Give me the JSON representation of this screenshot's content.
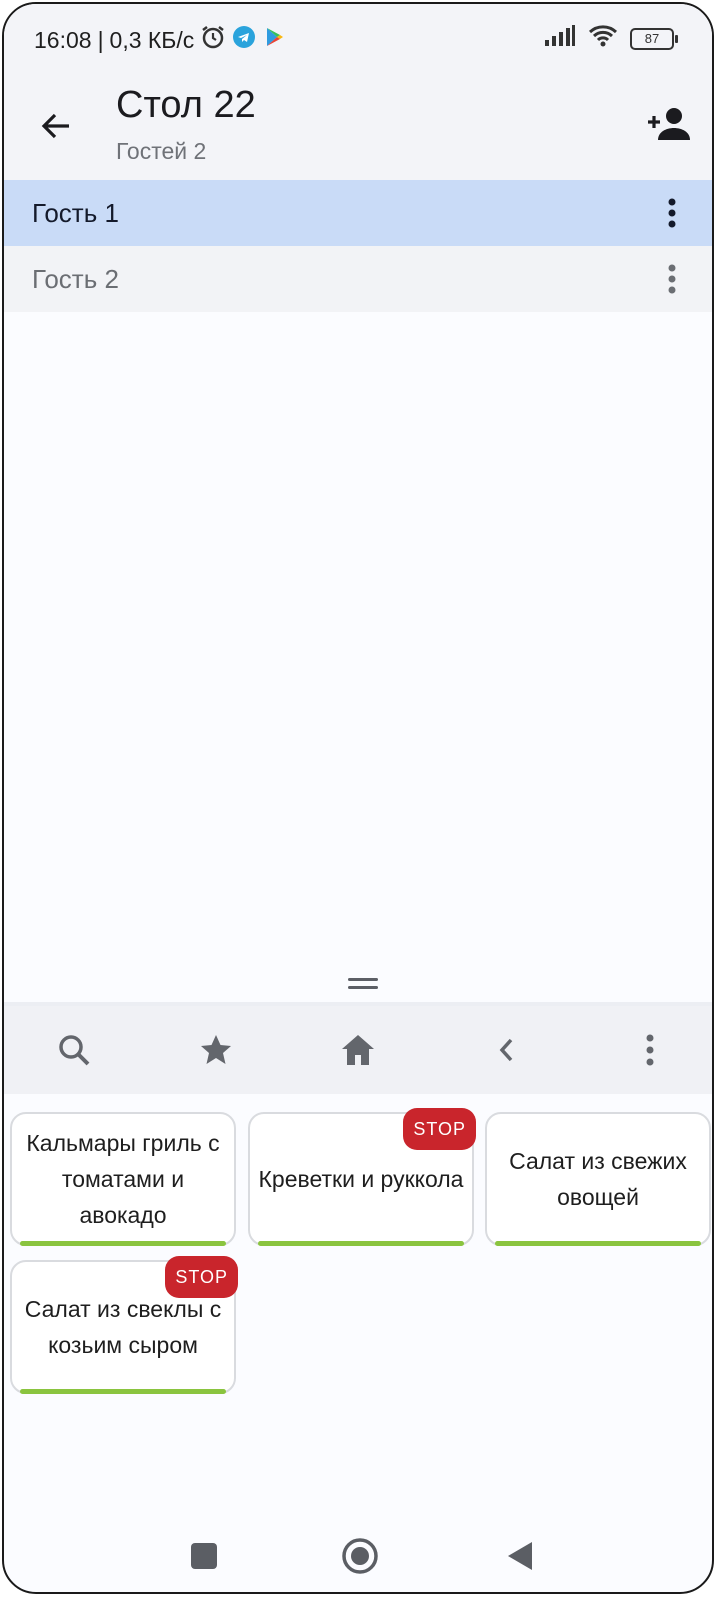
{
  "status_bar": {
    "time": "16:08",
    "separator": "|",
    "network_speed": "0,3 КБ/с",
    "battery_level": "87",
    "icons": [
      "alarm-icon",
      "telegram-icon",
      "play-store-icon",
      "signal-icon",
      "wifi-icon",
      "battery-icon"
    ]
  },
  "app_bar": {
    "title": "Стол 22",
    "subtitle": "Гостей 2",
    "back_icon": "arrow-back-icon",
    "action_icon": "person-add-icon"
  },
  "guests": [
    {
      "label": "Гость 1",
      "selected": true
    },
    {
      "label": "Гость 2",
      "selected": false
    }
  ],
  "toolbar": {
    "icons": [
      "search-icon",
      "star-icon",
      "home-icon",
      "chevron-left-icon",
      "more-vert-icon"
    ]
  },
  "menu_items": [
    {
      "label": "Кальмары гриль с томатами и авокадо",
      "stop": false
    },
    {
      "label": "Креветки и руккола",
      "stop": true,
      "badge": "STOP"
    },
    {
      "label": "Салат из свежих овощей",
      "stop": false
    },
    {
      "label": "Салат из свеклы с козьим сыром",
      "stop": true,
      "badge": "STOP"
    }
  ],
  "nav_bar": {
    "icons": [
      "recents-square-icon",
      "home-circle-icon",
      "back-triangle-icon"
    ]
  },
  "colors": {
    "accent_selected_row": "#c9dbf7",
    "stop_badge": "#c9252c",
    "tile_bar": "#8ac43f",
    "surface": "#f3f4f8"
  }
}
